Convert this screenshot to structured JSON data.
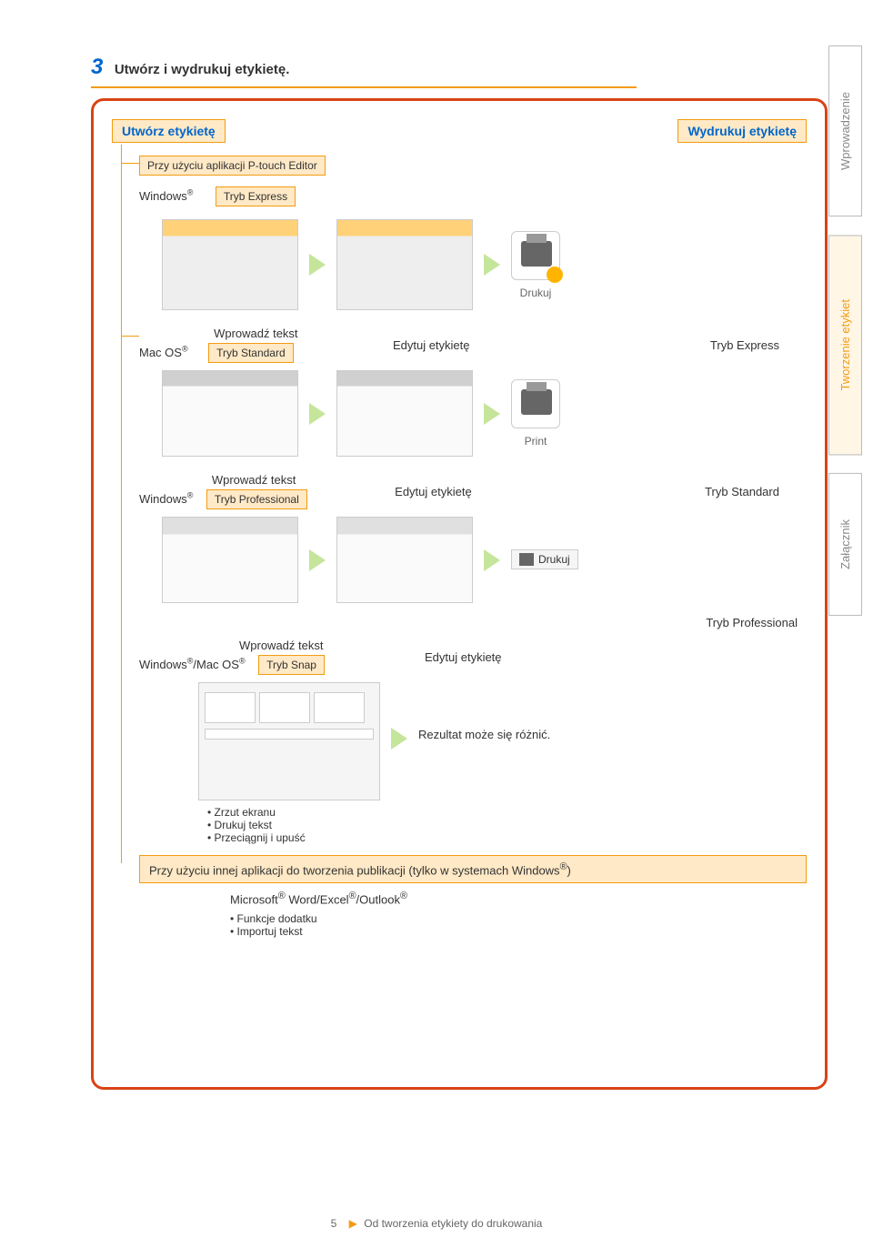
{
  "step": {
    "number": "3",
    "title": "Utwórz i wydrukuj etykietę."
  },
  "labels": {
    "create": "Utwórz etykietę",
    "print": "Wydrukuj etykietę",
    "using_app": "Przy użyciu aplikacji P-touch Editor",
    "mode_express": "Tryb Express",
    "mode_standard": "Tryb Standard",
    "mode_professional": "Tryb Professional",
    "mode_snap": "Tryb Snap",
    "enter_text": "Wprowadź tekst",
    "edit_label": "Edytuj etykietę",
    "result_may_vary": "Rezultat może się różnić.",
    "using_other_app": "Przy użyciu innej aplikacji do tworzenia publikacji (tylko w systemach Windows®)",
    "ms_line": "Microsoft® Word/Excel®/Outlook®",
    "addon_fn": "Funkcje dodatku",
    "import_text": "Importuj tekst",
    "screenshot": "Zrzut ekranu",
    "print_text": "Drukuj tekst",
    "drag_drop": "Przeciągnij i upuść",
    "tryb_express_side": "Tryb Express",
    "tryb_standard_side": "Tryb Standard",
    "tryb_professional_side": "Tryb Professional"
  },
  "os": {
    "windows": "Windows®",
    "macos": "Mac OS®",
    "combo": "Windows®/Mac OS®"
  },
  "print_icons": {
    "drukuj": "Drukuj",
    "print_en": "Print"
  },
  "side_nav": {
    "intro": "Wprowadzenie",
    "creating": "Tworzenie etykiet",
    "appendix": "Załącznik"
  },
  "footer": {
    "page": "5",
    "crumb": "Od tworzenia etykiety do drukowania"
  }
}
